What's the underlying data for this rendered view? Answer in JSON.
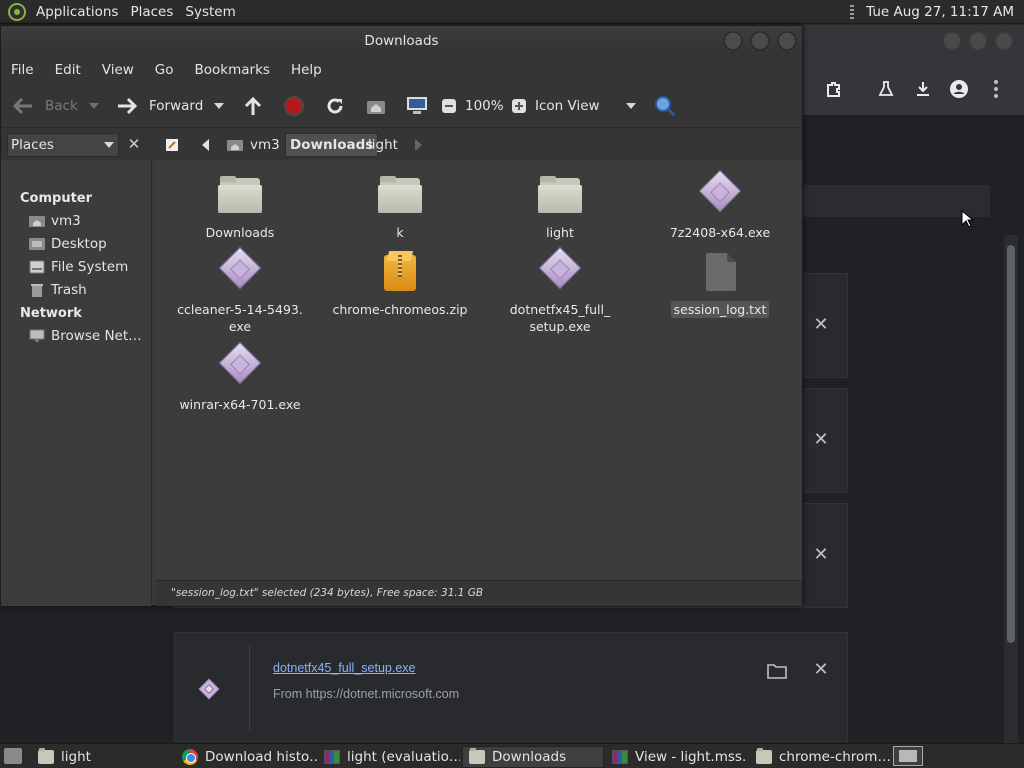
{
  "top_panel": {
    "menus": [
      "Applications",
      "Places",
      "System"
    ],
    "clock": "Tue Aug 27, 11:17 AM"
  },
  "file_manager": {
    "title": "Downloads",
    "menu": [
      "File",
      "Edit",
      "View",
      "Go",
      "Bookmarks",
      "Help"
    ],
    "toolbar": {
      "back": "Back",
      "forward": "Forward",
      "zoom": "100%",
      "view_mode": "Icon View"
    },
    "sidebar_combo": "Places",
    "breadcrumbs": [
      "vm3",
      "Downloads",
      "light"
    ],
    "sidebar": {
      "computer_heading": "Computer",
      "computer_items": [
        {
          "label": "vm3",
          "icon": "home-folder-icon"
        },
        {
          "label": "Desktop",
          "icon": "desktop-icon"
        },
        {
          "label": "File System",
          "icon": "drive-icon"
        },
        {
          "label": "Trash",
          "icon": "trash-icon"
        }
      ],
      "network_heading": "Network",
      "network_items": [
        {
          "label": "Browse Net…",
          "icon": "network-icon"
        }
      ]
    },
    "files": [
      {
        "name": "Downloads",
        "type": "folder"
      },
      {
        "name": "k",
        "type": "folder"
      },
      {
        "name": "light",
        "type": "folder"
      },
      {
        "name": "7z2408-x64.exe",
        "type": "exe"
      },
      {
        "name": "ccleaner-5-14-5493.\nexe",
        "type": "exe"
      },
      {
        "name": "chrome-chromeos.zip",
        "type": "zip"
      },
      {
        "name": "dotnetfx45_full_\nsetup.exe",
        "type": "exe"
      },
      {
        "name": "session_log.txt",
        "type": "txt",
        "selected": true
      },
      {
        "name": "winrar-x64-701.exe",
        "type": "exe"
      }
    ],
    "status": "\"session_log.txt\" selected (234 bytes), Free space: 31.1 GB"
  },
  "chrome": {
    "download_card": {
      "filename": "dotnetfx45_full_setup.exe",
      "source": "From https://dotnet.microsoft.com"
    }
  },
  "taskbar": {
    "tasks": [
      {
        "label": "light",
        "icon": "folder-icon"
      },
      {
        "label": "Download histo…",
        "icon": "chrome-icon"
      },
      {
        "label": "light (evaluatio…",
        "icon": "winrar-icon"
      },
      {
        "label": "Downloads",
        "icon": "folder-icon",
        "active": true
      },
      {
        "label": "View - light.mss…",
        "icon": "winrar-icon"
      },
      {
        "label": "chrome-chrom…",
        "icon": "folder-icon"
      }
    ]
  }
}
